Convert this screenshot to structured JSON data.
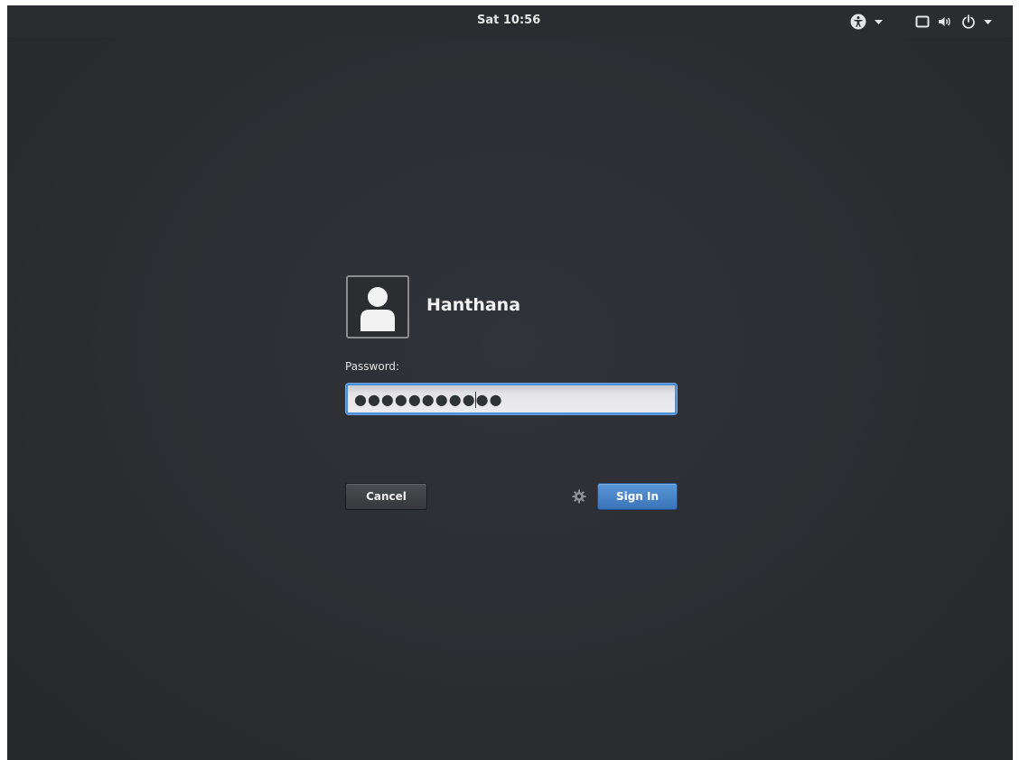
{
  "topbar": {
    "clock": "Sat 10:56",
    "icons": {
      "accessibility": "accessibility-icon",
      "accessibility_arrow": "chevron-down-icon",
      "display": "display-icon",
      "volume": "volume-icon",
      "power": "power-icon",
      "system_arrow": "chevron-down-icon"
    }
  },
  "login": {
    "user_name": "Hanthana",
    "avatar_icon": "user-avatar-icon",
    "password_label": "Password:",
    "password_masked": "●●●●●●●●●●●",
    "cancel_label": "Cancel",
    "session_icon": "gear-icon",
    "signin_label": "Sign In"
  },
  "colors": {
    "background": "#2b2d31",
    "accent": "#3a74bb",
    "focus_ring": "#4a90d9"
  }
}
